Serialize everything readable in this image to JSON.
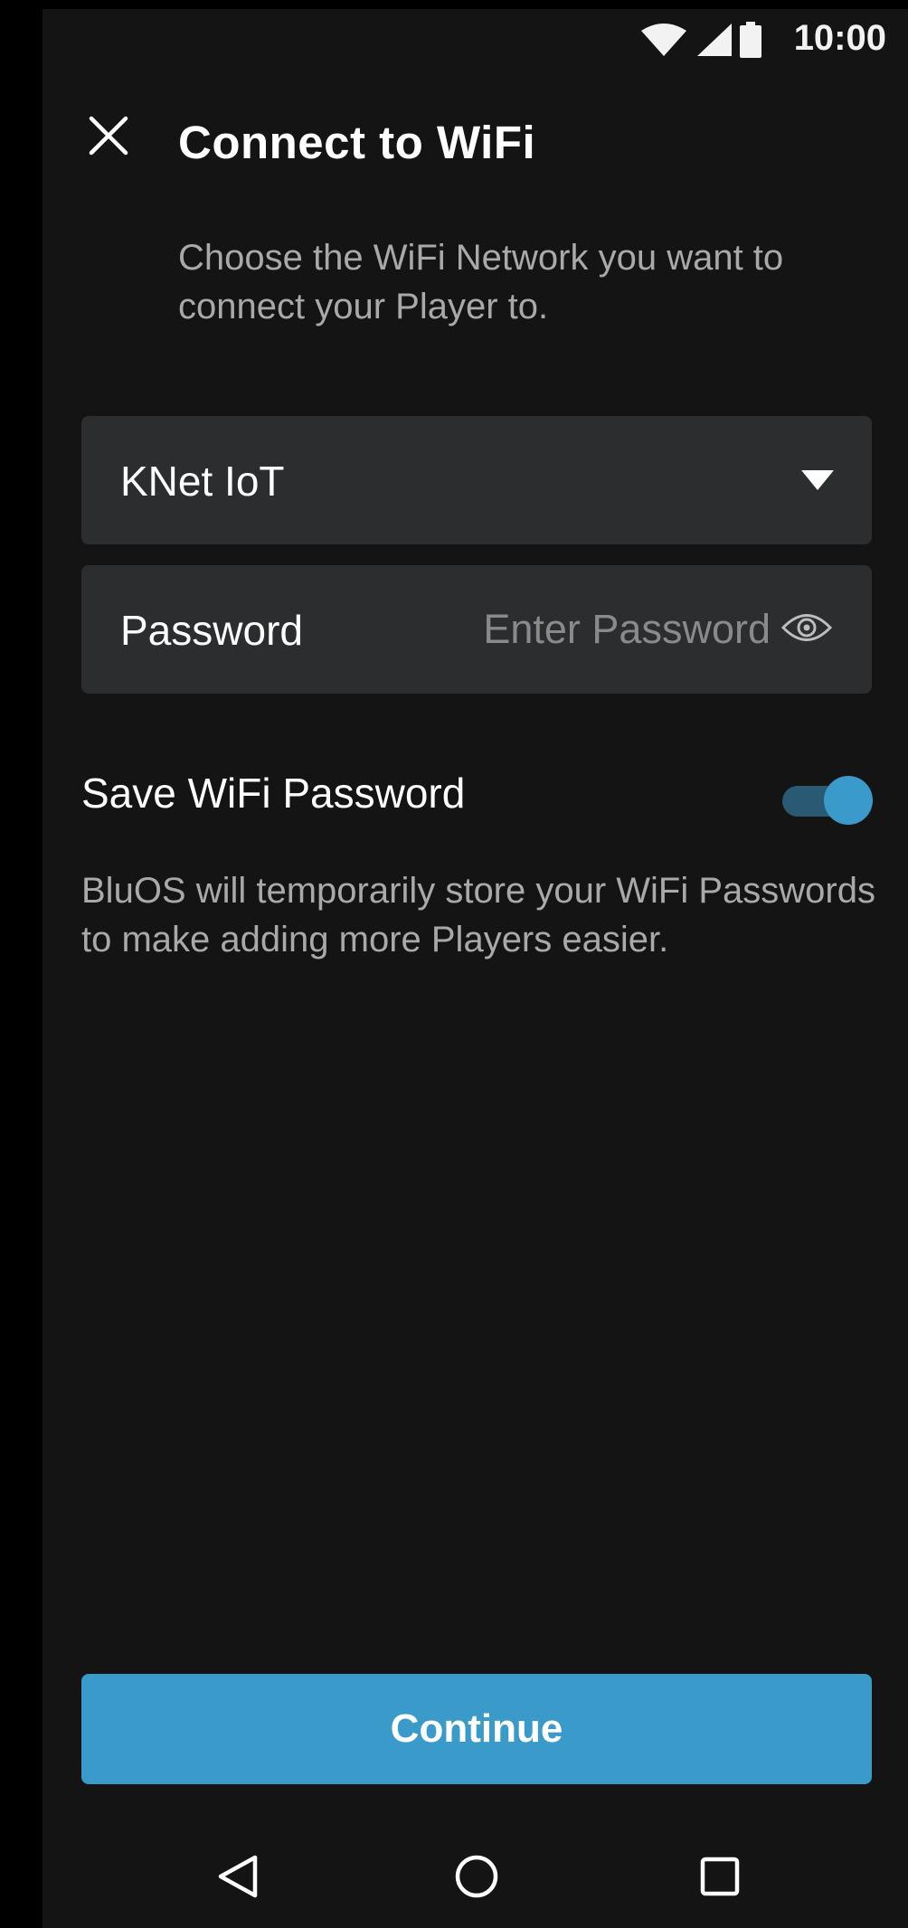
{
  "status_bar": {
    "time": "10:00",
    "icons": [
      "wifi-icon",
      "cellular-signal-icon",
      "battery-icon"
    ]
  },
  "header": {
    "close_icon": "close-icon",
    "title": "Connect to WiFi",
    "subtitle": "Choose the WiFi Network you want to connect your Player to."
  },
  "network_select": {
    "selected": "KNet IoT",
    "icon": "caret-down-icon"
  },
  "password": {
    "label": "Password",
    "value": "",
    "placeholder": "Enter Password",
    "icon": "eye-icon"
  },
  "save_password": {
    "label": "Save WiFi Password",
    "enabled": true,
    "description": "BluOS will temporarily store your WiFi Passwords to make adding more Players easier."
  },
  "continue_label": "Continue",
  "nav": [
    "back-icon",
    "home-icon",
    "recents-icon"
  ],
  "colors": {
    "background": "#141414",
    "field": "#2b2d2f",
    "accent": "#3a9bcb",
    "muted_text": "#a9a9a9"
  }
}
